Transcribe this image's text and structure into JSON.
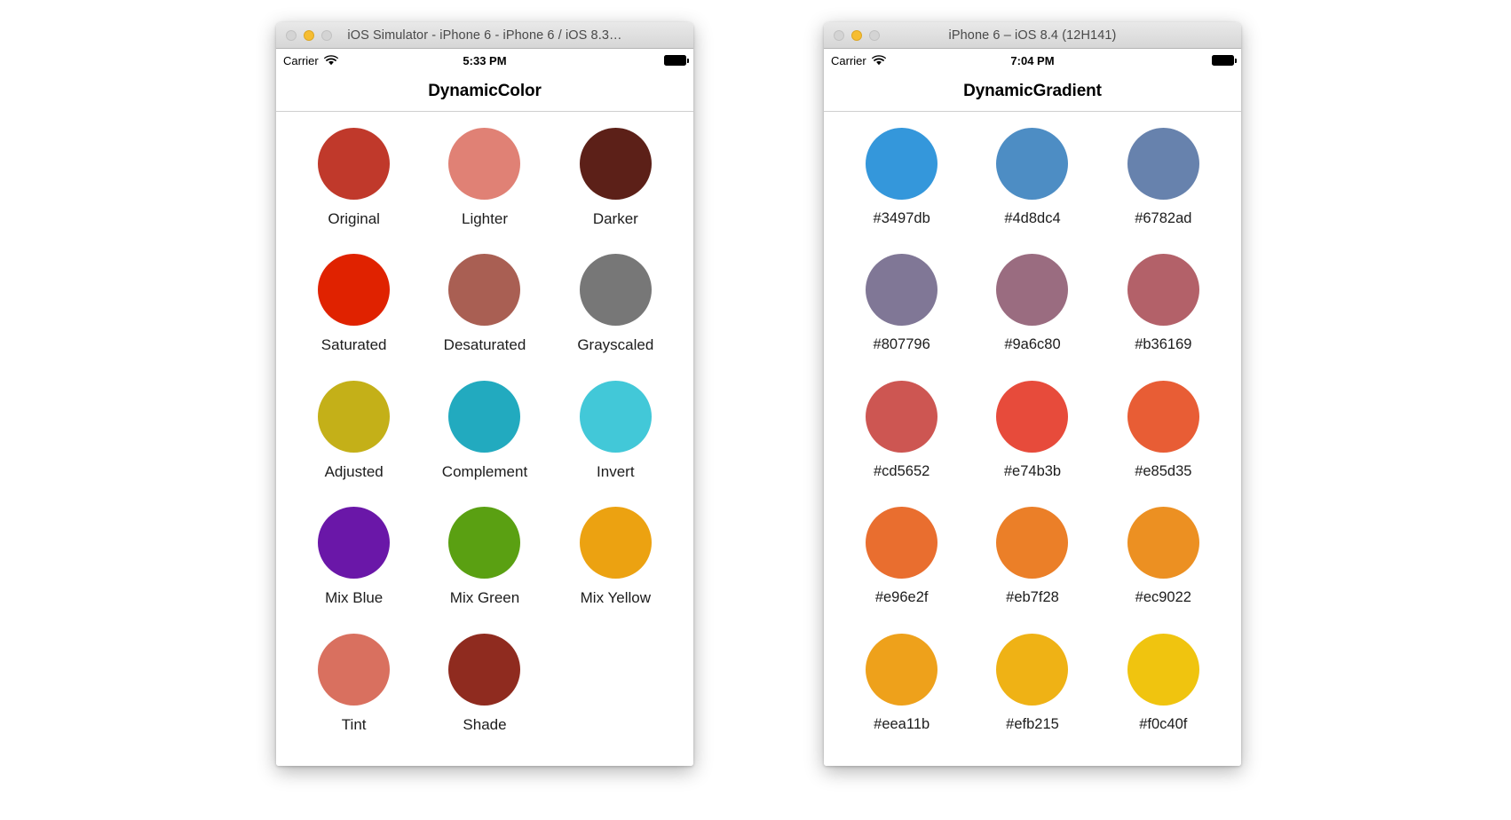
{
  "windows": [
    {
      "id": "dynamic-color",
      "window_title": "iOS Simulator - iPhone 6 - iPhone 6 / iOS 8.3…",
      "traffic_lights": [
        "close-button",
        "minimize-button",
        "zoom-button"
      ],
      "status_bar": {
        "carrier": "Carrier",
        "wifi_icon": "wifi-icon",
        "time": "5:33 PM",
        "battery_icon": "battery-full-icon"
      },
      "nav_title": "DynamicColor",
      "swatches": [
        {
          "label": "Original",
          "color": "#c0392b"
        },
        {
          "label": "Lighter",
          "color": "#e08175"
        },
        {
          "label": "Darker",
          "color": "#5c2018"
        },
        {
          "label": "Saturated",
          "color": "#e02200"
        },
        {
          "label": "Desaturated",
          "color": "#a95f53"
        },
        {
          "label": "Grayscaled",
          "color": "#777777"
        },
        {
          "label": "Adjusted",
          "color": "#c4b018"
        },
        {
          "label": "Complement",
          "color": "#22aabf"
        },
        {
          "label": "Invert",
          "color": "#42c8d8"
        },
        {
          "label": "Mix Blue",
          "color": "#6a17a8"
        },
        {
          "label": "Mix Green",
          "color": "#5aa012"
        },
        {
          "label": "Mix Yellow",
          "color": "#eca211"
        },
        {
          "label": "Tint",
          "color": "#d9705f"
        },
        {
          "label": "Shade",
          "color": "#8f2b1f"
        }
      ]
    },
    {
      "id": "dynamic-gradient",
      "window_title": "iPhone 6 – iOS 8.4 (12H141)",
      "traffic_lights": [
        "close-button",
        "minimize-button",
        "zoom-button"
      ],
      "status_bar": {
        "carrier": "Carrier",
        "wifi_icon": "wifi-icon",
        "time": "7:04 PM",
        "battery_icon": "battery-full-icon"
      },
      "nav_title": "DynamicGradient",
      "swatches": [
        {
          "label": "#3497db",
          "color": "#3497db"
        },
        {
          "label": "#4d8dc4",
          "color": "#4d8dc4"
        },
        {
          "label": "#6782ad",
          "color": "#6782ad"
        },
        {
          "label": "#807796",
          "color": "#807796"
        },
        {
          "label": "#9a6c80",
          "color": "#9a6c80"
        },
        {
          "label": "#b36169",
          "color": "#b36169"
        },
        {
          "label": "#cd5652",
          "color": "#cd5652"
        },
        {
          "label": "#e74b3b",
          "color": "#e74b3b"
        },
        {
          "label": "#e85d35",
          "color": "#e85d35"
        },
        {
          "label": "#e96e2f",
          "color": "#e96e2f"
        },
        {
          "label": "#eb7f28",
          "color": "#eb7f28"
        },
        {
          "label": "#ec9022",
          "color": "#ec9022"
        },
        {
          "label": "#eea11b",
          "color": "#eea11b"
        },
        {
          "label": "#efb215",
          "color": "#efb215"
        },
        {
          "label": "#f0c40f",
          "color": "#f0c40f"
        }
      ]
    }
  ]
}
